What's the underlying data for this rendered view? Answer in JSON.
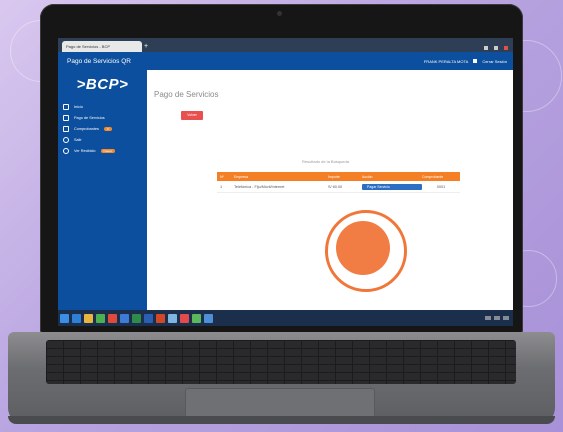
{
  "browser": {
    "tab_title": "Pago de Servicios - BCP",
    "new_tab": "+"
  },
  "header": {
    "app_title": "Pago de Servicios QR",
    "user_name": "FRANK PERALTA MOTA",
    "logout_label": "Cerrar Sesión"
  },
  "sidebar": {
    "logo": ">BCP>",
    "items": [
      {
        "label": "Inicio",
        "icon": "home-icon"
      },
      {
        "label": "Pago de Servicios",
        "icon": "payment-icon"
      },
      {
        "label": "Comprobantes",
        "icon": "receipt-icon",
        "badge": "0"
      },
      {
        "label": "Salir",
        "icon": "exit-icon"
      },
      {
        "label": "Ver Recibido",
        "icon": "info-icon",
        "badge": "Nuevo"
      }
    ]
  },
  "main": {
    "page_title": "Pago de Servicios",
    "back_button": "Volver",
    "results_label": "Resultado de la Búsqueda",
    "table": {
      "headers": [
        "Nº",
        "Empresa",
        "Importe",
        "Acción",
        "Comprobante"
      ],
      "rows": [
        {
          "num": "1",
          "empresa": "Telefónica - Fijo/Móvil/Internet",
          "importe": "S/ 60.00",
          "accion": "Pagar Servicio",
          "comprobante": "0001"
        }
      ]
    }
  },
  "colors": {
    "brand_blue": "#0c4f9e",
    "accent_orange": "#f57f24",
    "back_red": "#e85050",
    "pay_blue": "#2b6ec2"
  }
}
